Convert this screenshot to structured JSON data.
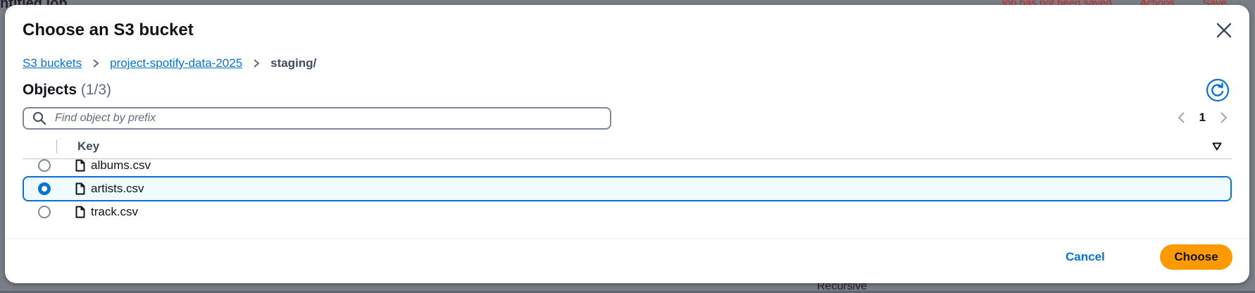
{
  "background": {
    "left_title": "ntitled job",
    "right_status": "Job has not been saved",
    "right_actions": "Actions",
    "right_save": "Save",
    "bottom_checkbox": "Recursive"
  },
  "modal": {
    "title": "Choose an S3 bucket",
    "close_icon": "close-icon"
  },
  "breadcrumb": {
    "items": [
      "S3 buckets",
      "project-spotify-data-2025"
    ],
    "current": "staging/"
  },
  "objects": {
    "heading": "Objects",
    "count": "(1/3)"
  },
  "search": {
    "placeholder": "Find object by prefix",
    "value": ""
  },
  "pagination": {
    "current_page": "1"
  },
  "table": {
    "column_key": "Key",
    "rows": [
      {
        "name": "albums.csv",
        "selected": false
      },
      {
        "name": "artists.csv",
        "selected": true
      },
      {
        "name": "track.csv",
        "selected": false
      }
    ]
  },
  "footer": {
    "cancel_label": "Cancel",
    "choose_label": "Choose"
  },
  "colors": {
    "accent": "#0972d3",
    "primary_button": "#ff9900",
    "selected_row_bg": "#f0fbff"
  }
}
